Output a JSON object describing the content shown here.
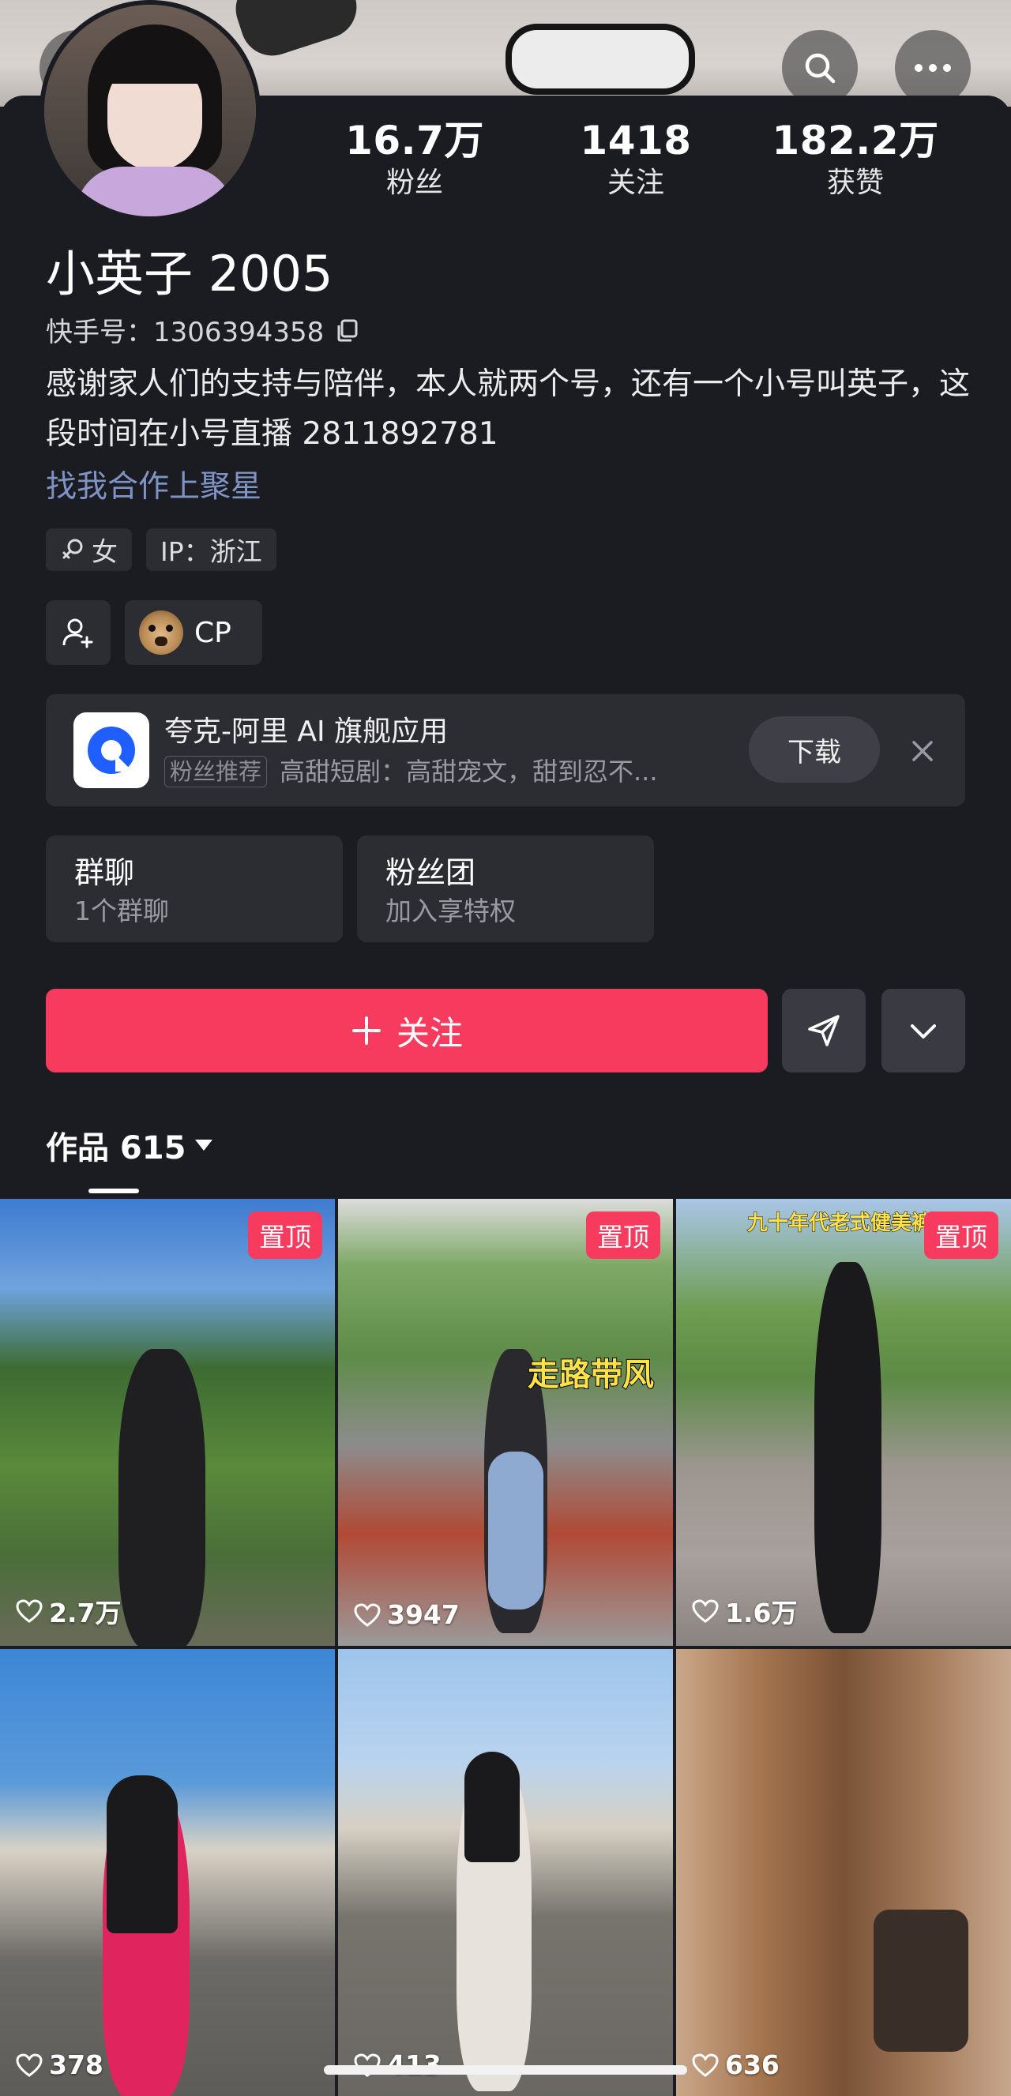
{
  "profile": {
    "stats": [
      {
        "num": "16.7万",
        "label": "粉丝"
      },
      {
        "num": "1418",
        "label": "关注"
      },
      {
        "num": "182.2万",
        "label": "获赞"
      }
    ],
    "name": "小英子 2005",
    "kuaishou_id": "快手号：1306394358",
    "bio": "感谢家人们的支持与陪伴，本人就两个号，还有一个小号叫英子，这段时间在小号直播 2811892781",
    "cooperation_link": "找我合作上聚星",
    "gender_chip": "女",
    "ip_chip": "IP：浙江",
    "cp_label": "CP"
  },
  "ad": {
    "title": "夸克-阿里 AI 旗舰应用",
    "tag": "粉丝推荐",
    "desc": "高甜短剧：高甜宠文，甜到忍不...",
    "download": "下载"
  },
  "cards": [
    {
      "title": "群聊",
      "sub": "1个群聊"
    },
    {
      "title": "粉丝团",
      "sub": "加入享特权"
    }
  ],
  "actions": {
    "follow": "关注"
  },
  "tabs": {
    "works": "作品 615"
  },
  "videos": [
    {
      "likes": "2.7万",
      "pinned": "置顶",
      "overlay": ""
    },
    {
      "likes": "3947",
      "pinned": "置顶",
      "overlay": "走路带风"
    },
    {
      "likes": "1.6万",
      "pinned": "置顶",
      "overlay": "九十年代老式健美裤"
    },
    {
      "likes": "378",
      "pinned": "",
      "overlay": ""
    },
    {
      "likes": "413",
      "pinned": "",
      "overlay": ""
    },
    {
      "likes": "636",
      "pinned": "",
      "overlay": ""
    }
  ],
  "colors": {
    "accent": "#f63b5e",
    "bg": "#1b1b22",
    "card": "#2c2c33",
    "link": "#7f94c4"
  }
}
